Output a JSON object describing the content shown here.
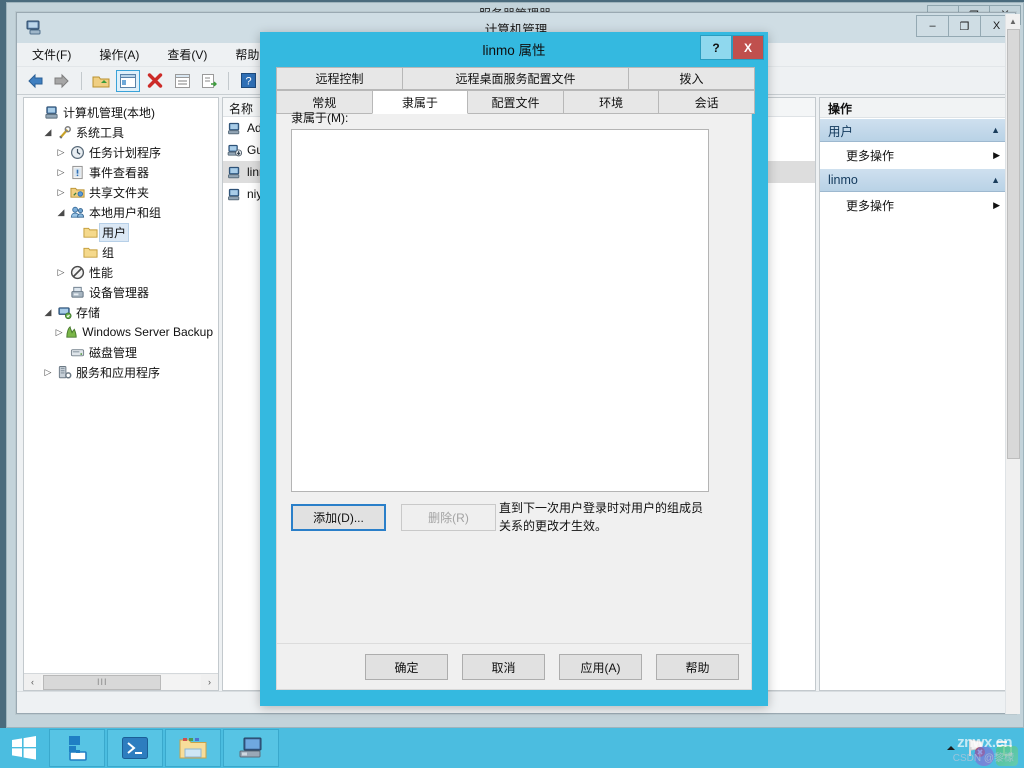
{
  "desktop": {
    "charms": [
      "search-icon",
      "windows-icon",
      "settings-icon"
    ]
  },
  "server_manager": {
    "title": "服务器管理器",
    "caption": {
      "minimize": "–",
      "restore": "❐",
      "close": "X"
    }
  },
  "computer_management": {
    "title": "计算机管理",
    "app_icon": "computer-management-icon",
    "caption": {
      "minimize": "–",
      "maximize": "❐",
      "close": "X"
    },
    "menu": [
      {
        "label": "文件(F)"
      },
      {
        "label": "操作(A)"
      },
      {
        "label": "查看(V)"
      },
      {
        "label": "帮助(H)"
      }
    ],
    "toolbar": [
      {
        "name": "back-icon"
      },
      {
        "name": "forward-icon"
      },
      {
        "name": "up-folder-icon"
      },
      {
        "name": "show-tree-icon"
      },
      {
        "name": "delete-icon"
      },
      {
        "name": "properties-icon"
      },
      {
        "name": "export-list-icon"
      },
      {
        "name": "help-icon"
      },
      {
        "name": "show-action-pane-icon"
      }
    ],
    "tree": [
      {
        "label": "计算机管理(本地)",
        "indent": 0,
        "expander": "none",
        "icon": "computer-icon"
      },
      {
        "label": "系统工具",
        "indent": 1,
        "expander": "expanded",
        "icon": "tools-icon"
      },
      {
        "label": "任务计划程序",
        "indent": 2,
        "expander": "collapsed",
        "icon": "clock-icon"
      },
      {
        "label": "事件查看器",
        "indent": 2,
        "expander": "collapsed",
        "icon": "event-icon"
      },
      {
        "label": "共享文件夹",
        "indent": 2,
        "expander": "collapsed",
        "icon": "shared-folder-icon"
      },
      {
        "label": "本地用户和组",
        "indent": 2,
        "expander": "expanded",
        "icon": "users-icon"
      },
      {
        "label": "用户",
        "indent": 3,
        "expander": "none",
        "icon": "folder-icon",
        "selected": true
      },
      {
        "label": "组",
        "indent": 3,
        "expander": "none",
        "icon": "folder-icon"
      },
      {
        "label": "性能",
        "indent": 2,
        "expander": "collapsed",
        "icon": "performance-icon"
      },
      {
        "label": "设备管理器",
        "indent": 2,
        "expander": "none",
        "icon": "device-manager-icon"
      },
      {
        "label": "存储",
        "indent": 1,
        "expander": "expanded",
        "icon": "storage-icon"
      },
      {
        "label": "Windows Server Backup",
        "indent": 2,
        "expander": "collapsed",
        "icon": "backup-icon"
      },
      {
        "label": "磁盘管理",
        "indent": 2,
        "expander": "none",
        "icon": "disk-icon"
      },
      {
        "label": "服务和应用程序",
        "indent": 1,
        "expander": "collapsed",
        "icon": "services-icon"
      }
    ],
    "list": {
      "columns": [
        "名称"
      ],
      "rows": [
        {
          "name": "Administrator",
          "icon": "user-icon"
        },
        {
          "name": "Guest",
          "icon": "user-disabled-icon"
        },
        {
          "name": "linmo",
          "icon": "user-icon",
          "selected": true
        },
        {
          "name": "niyinlin",
          "icon": "user-icon"
        }
      ]
    },
    "actions": {
      "header": "操作",
      "groups": [
        {
          "title": "用户",
          "items": [
            {
              "label": "更多操作",
              "submenu": true
            }
          ]
        },
        {
          "title": "linmo",
          "items": [
            {
              "label": "更多操作",
              "submenu": true
            }
          ]
        }
      ]
    },
    "hscroll": {
      "left": "‹",
      "right": "›",
      "grip": "III"
    }
  },
  "dialog": {
    "title": "linmo 属性",
    "caption": {
      "help": "?",
      "close": "X"
    },
    "tabs_row1": [
      {
        "label": "远程控制",
        "active": false
      },
      {
        "label": "远程桌面服务配置文件",
        "active": false
      },
      {
        "label": "拨入",
        "active": false
      }
    ],
    "tabs_row2": [
      {
        "label": "常规",
        "active": false
      },
      {
        "label": "隶属于",
        "active": true
      },
      {
        "label": "配置文件",
        "active": false
      },
      {
        "label": "环境",
        "active": false
      },
      {
        "label": "会话",
        "active": false
      }
    ],
    "member_label": "隶属于(M):",
    "member_items": [],
    "add_button": "添加(D)...",
    "remove_button": "删除(R)",
    "hint": "直到下一次用户登录时对用户的组成员关系的更改才生效。",
    "bottom_buttons": [
      {
        "label": "确定"
      },
      {
        "label": "取消"
      },
      {
        "label": "应用(A)"
      },
      {
        "label": "帮助"
      }
    ]
  },
  "taskbar": {
    "start": "windows-start-icon",
    "apps": [
      {
        "name": "server-manager-icon"
      },
      {
        "name": "powershell-icon"
      },
      {
        "name": "file-explorer-icon"
      },
      {
        "name": "computer-management-icon"
      }
    ],
    "tray": [
      {
        "name": "show-hidden-icons-arrow"
      },
      {
        "name": "network-warning-icon"
      },
      {
        "name": "action-center-icon"
      }
    ],
    "watermark": {
      "text": "znwx.cn",
      "sub": "CSDN @黎檬"
    }
  },
  "colors": {
    "accent": "#34b9e0",
    "taskbar": "#4bbde0",
    "close_red": "#c0504d",
    "group_header": "#cfe0ef"
  }
}
